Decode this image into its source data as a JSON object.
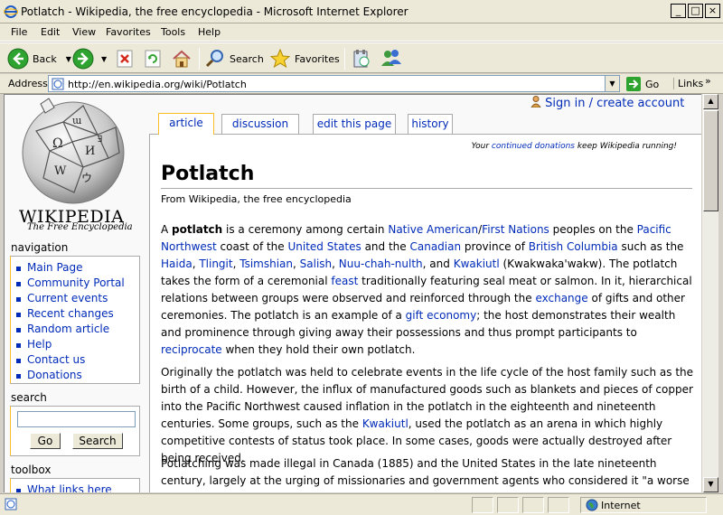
{
  "window": {
    "title": "Potlatch - Wikipedia, the free encyclopedia - Microsoft Internet Explorer",
    "min": "_",
    "max": "□",
    "close": "×"
  },
  "menu": [
    "File",
    "Edit",
    "View",
    "Favorites",
    "Tools",
    "Help"
  ],
  "toolbar": {
    "back": "Back",
    "search": "Search",
    "favorites": "Favorites"
  },
  "address": {
    "label": "Address",
    "url": "http://en.wikipedia.org/wiki/Potlatch",
    "go": "Go",
    "links": "Links"
  },
  "wiki": {
    "logo_word": "WIKIPEDIA",
    "logo_tagline": "The Free Encyclopedia",
    "user_links": "Sign in / create account",
    "tabs": [
      "article",
      "discussion",
      "edit this page",
      "history"
    ],
    "navigation": {
      "title": "navigation",
      "items": [
        "Main Page",
        "Community Portal",
        "Current events",
        "Recent changes",
        "Random article",
        "Help",
        "Contact us",
        "Donations"
      ]
    },
    "search": {
      "title": "search",
      "go": "Go",
      "search": "Search"
    },
    "toolbox": {
      "title": "toolbox",
      "items": [
        "What links here"
      ]
    },
    "sitenotice": {
      "before": "Your ",
      "link": "continued donations",
      "after": " keep Wikipedia running!"
    },
    "heading": "Potlatch",
    "sitesub": "From Wikipedia, the free encyclopedia"
  },
  "status": {
    "zone": "Internet"
  },
  "colors": {
    "link": "#002bb8",
    "tab_selected_border": "#fabd23",
    "content_bg": "#ffffff",
    "page_bg": "#f9f9f9"
  }
}
